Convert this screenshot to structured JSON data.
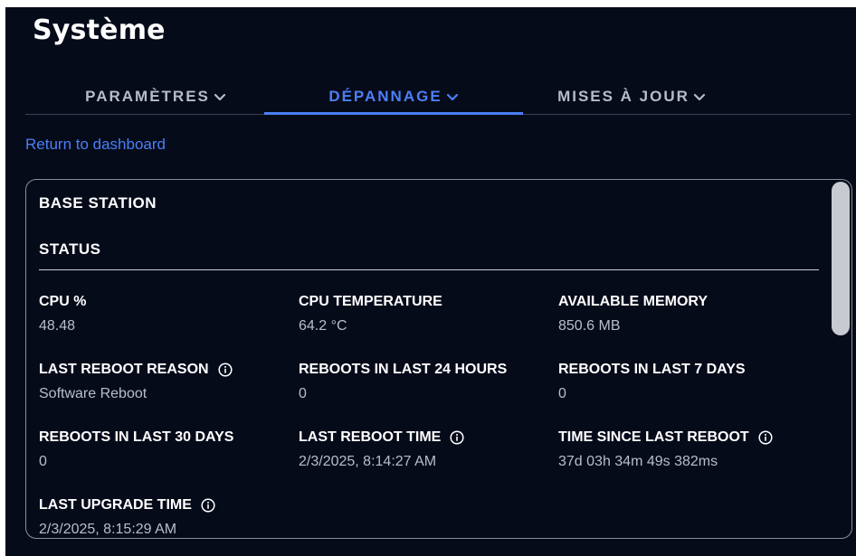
{
  "page": {
    "title": "Système"
  },
  "tabs": [
    {
      "label": "PARAMÈTRES",
      "active": false
    },
    {
      "label": "DÉPANNAGE",
      "active": true
    },
    {
      "label": "MISES À JOUR",
      "active": false
    }
  ],
  "return_link": "Return to dashboard",
  "card": {
    "title": "BASE STATION",
    "section": "STATUS",
    "stats": [
      {
        "label": "CPU %",
        "value": "48.48",
        "info": false
      },
      {
        "label": "CPU TEMPERATURE",
        "value": "64.2 °C",
        "info": false
      },
      {
        "label": "AVAILABLE MEMORY",
        "value": "850.6 MB",
        "info": false
      },
      {
        "label": "LAST REBOOT REASON",
        "value": "Software Reboot",
        "info": true
      },
      {
        "label": "REBOOTS IN LAST 24 HOURS",
        "value": "0",
        "info": false
      },
      {
        "label": "REBOOTS IN LAST 7 DAYS",
        "value": "0",
        "info": false
      },
      {
        "label": "REBOOTS IN LAST 30 DAYS",
        "value": "0",
        "info": false
      },
      {
        "label": "LAST REBOOT TIME",
        "value": "2/3/2025, 8:14:27 AM",
        "info": true
      },
      {
        "label": "TIME SINCE LAST REBOOT",
        "value": "37d 03h 34m 49s 382ms",
        "info": true
      },
      {
        "label": "LAST UPGRADE TIME",
        "value": "2/3/2025, 8:15:29 AM",
        "info": true
      }
    ]
  },
  "icons": {
    "tab_dropdown": "chevron-down-icon",
    "info": "info-icon"
  },
  "colors": {
    "background": "#060b1a",
    "accent": "#4b7ff5",
    "text_primary": "#ffffff",
    "text_secondary": "#b9bec8"
  }
}
